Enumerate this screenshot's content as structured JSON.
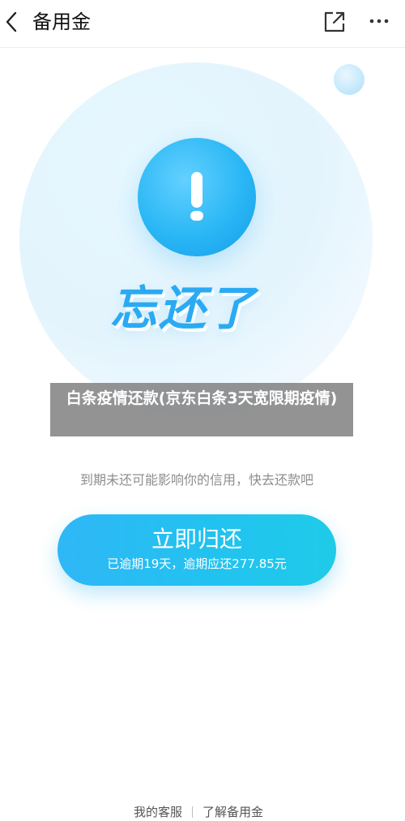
{
  "header": {
    "title": "备用金",
    "icons": {
      "back": "chevron-left-icon",
      "share": "share-external-icon",
      "more": "more-dots-icon"
    }
  },
  "illustration": {
    "icon": "exclamation-icon",
    "headline": "忘还了"
  },
  "overlay": {
    "caption": "白条疫情还款(京东白条3天宽限期疫情)"
  },
  "main": {
    "info": "到期未还可能影响你的信用，快去还款吧",
    "repay_button": {
      "label": "立即归还",
      "subtext": "已逾期19天，逾期应还277.85元"
    }
  },
  "footer": {
    "links": [
      "我的客服",
      "了解备用金"
    ]
  },
  "colors": {
    "accent": "#2aaaf3",
    "button_start": "#2fb7f6",
    "button_end": "#1fcbe8",
    "overlay": "#808080",
    "muted_text": "#8e8e8e"
  }
}
